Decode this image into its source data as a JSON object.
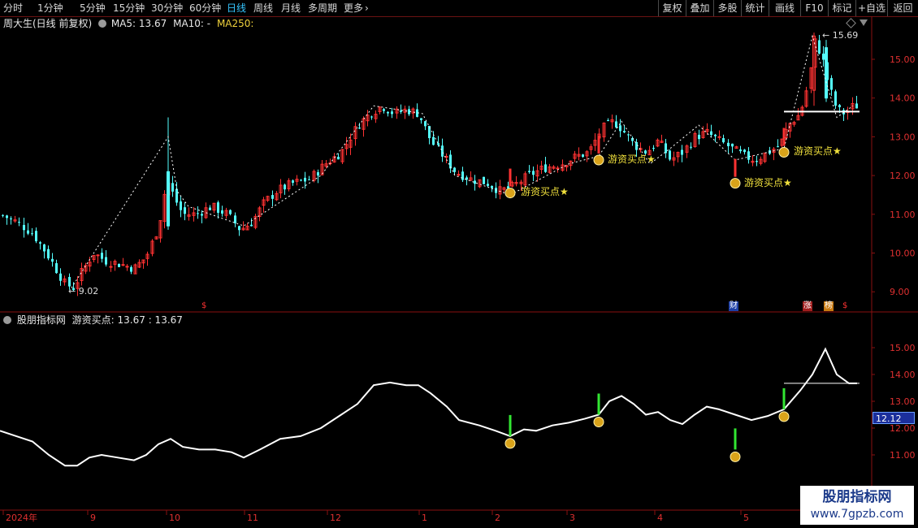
{
  "toolbar": {
    "periods": [
      "分时",
      "1分钟",
      "5分钟",
      "15分钟",
      "30分钟",
      "60分钟",
      "日线",
      "周线",
      "月线",
      "多周期",
      "更多"
    ],
    "active_period": "日线",
    "right_buttons": [
      "复权",
      "叠加",
      "多股",
      "统计",
      "画线",
      "F10",
      "标记",
      "+自选",
      "返回"
    ]
  },
  "main_pane": {
    "title": "周大生(日线 前复权)",
    "ma5": "MA5: 13.67",
    "ma10": "MA10: -",
    "ma250": "MA250:",
    "high_label": "15.69",
    "low_label": "9.02",
    "buy_signal_label": "游资买点★",
    "y_ticks": [
      "15.00",
      "14.00",
      "13.00",
      "12.00",
      "11.00",
      "10.00",
      "9.00"
    ],
    "event_markers": [
      "$",
      "财",
      "涨",
      "榜",
      "$"
    ]
  },
  "indicator_pane": {
    "title": "股朋指标网",
    "values": "游资买点: 13.67 : 13.67",
    "y_ticks": [
      "15.00",
      "14.00",
      "13.00",
      "12.00",
      "11.00"
    ],
    "price_tag": "12.12"
  },
  "x_axis": {
    "labels": [
      "2024年",
      "9",
      "10",
      "11",
      "12",
      "1",
      "2",
      "3",
      "4",
      "5"
    ]
  },
  "watermark": {
    "line1": "股朋指标网",
    "line2": "www.7gpzb.com"
  },
  "colors": {
    "up": "#ff3232",
    "down": "#54ffff",
    "signal": "#f0e03c",
    "line": "#ffffff",
    "border": "#8a1010"
  },
  "chart_data": [
    {
      "type": "candlestick",
      "title": "周大生(日线 前复权)",
      "ylim": [
        8.7,
        15.9
      ],
      "y_ticks": [
        9,
        10,
        11,
        12,
        13,
        14,
        15
      ],
      "x_labels": [
        "2024年",
        "9",
        "10",
        "11",
        "12",
        "1",
        "2",
        "3",
        "4",
        "5"
      ],
      "price_high": 15.69,
      "price_low": 9.02,
      "signals": [
        {
          "label": "游资买点★",
          "near_month": "2",
          "price": 11.6
        },
        {
          "label": "游资买点★",
          "near_month": "3",
          "price": 12.4
        },
        {
          "label": "游资买点★",
          "near_month": "4-5",
          "price": 11.8
        },
        {
          "label": "游资买点★",
          "near_month": "5",
          "price": 12.6
        }
      ]
    },
    {
      "type": "line",
      "title": "股朋指标网",
      "ylim": [
        10.3,
        16.0
      ],
      "y_ticks": [
        11,
        12,
        13,
        14,
        15
      ],
      "series": [
        {
          "name": "游资买点",
          "last_value": 13.67
        }
      ]
    }
  ]
}
